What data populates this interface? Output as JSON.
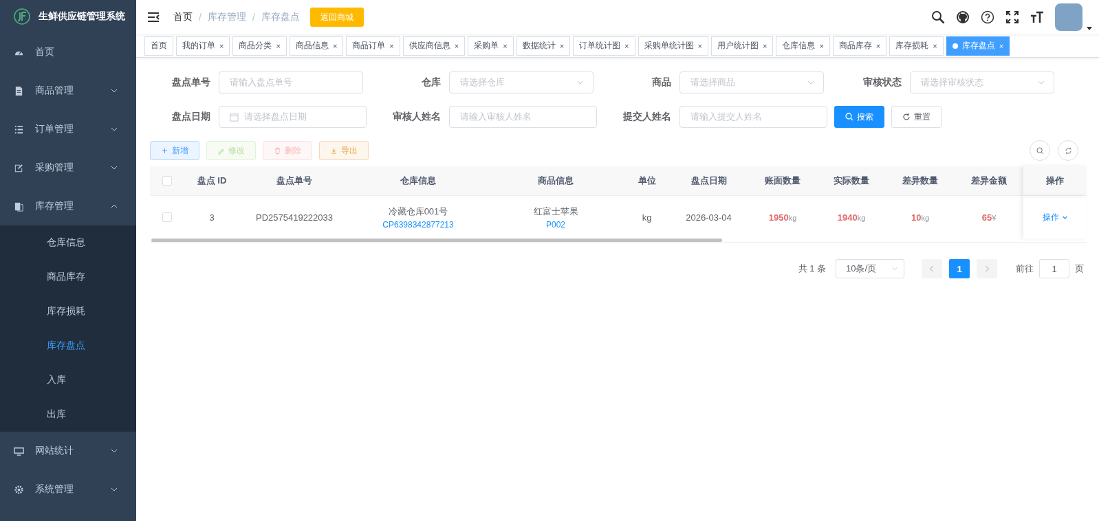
{
  "app": {
    "title": "生鲜供应链管理系统"
  },
  "sidebar": {
    "items": [
      {
        "label": "首页",
        "kind": "gauge",
        "selected": false
      },
      {
        "label": "商品管理",
        "kind": "doc",
        "selected": false,
        "expanded": false
      },
      {
        "label": "订单管理",
        "kind": "list",
        "selected": false,
        "expanded": false
      },
      {
        "label": "采购管理",
        "kind": "edit",
        "selected": false,
        "expanded": false
      },
      {
        "label": "库存管理",
        "kind": "copy",
        "selected": false,
        "expanded": true,
        "children": [
          {
            "label": "仓库信息",
            "selected": false
          },
          {
            "label": "商品库存",
            "selected": false
          },
          {
            "label": "库存损耗",
            "selected": false
          },
          {
            "label": "库存盘点",
            "selected": true
          },
          {
            "label": "入库",
            "selected": false
          },
          {
            "label": "出库",
            "selected": false
          }
        ]
      },
      {
        "label": "网站统计",
        "kind": "monitor",
        "selected": false,
        "expanded": false
      },
      {
        "label": "系统管理",
        "kind": "gear",
        "selected": false,
        "expanded": false
      }
    ]
  },
  "breadcrumb": [
    {
      "label": "首页",
      "link": true
    },
    {
      "label": "库存管理",
      "link": false
    },
    {
      "label": "库存盘点",
      "link": false
    }
  ],
  "breadcrumb_separator": "/",
  "return_button": "返回商城",
  "tags": [
    {
      "label": "首页",
      "selected": false
    },
    {
      "label": "我的订单",
      "selected": false,
      "close": "×"
    },
    {
      "label": "商品分类",
      "selected": false,
      "close": "×"
    },
    {
      "label": "商品信息",
      "selected": false,
      "close": "×"
    },
    {
      "label": "商品订单",
      "selected": false,
      "close": "×"
    },
    {
      "label": "供应商信息",
      "selected": false,
      "close": "×"
    },
    {
      "label": "采购单",
      "selected": false,
      "close": "×"
    },
    {
      "label": "数据统计",
      "selected": false,
      "close": "×"
    },
    {
      "label": "订单统计图",
      "selected": false,
      "close": "×"
    },
    {
      "label": "采购单统计图",
      "selected": false,
      "close": "×"
    },
    {
      "label": "用户统计图",
      "selected": false,
      "close": "×"
    },
    {
      "label": "仓库信息",
      "selected": false,
      "close": "×"
    },
    {
      "label": "商品库存",
      "selected": false,
      "close": "×"
    },
    {
      "label": "库存损耗",
      "selected": false,
      "close": "×"
    },
    {
      "label": "库存盘点",
      "selected": true,
      "close": "×"
    }
  ],
  "filters": [
    {
      "label": "盘点单号",
      "placeholder": "请输入盘点单号",
      "kind": "text"
    },
    {
      "label": "仓库",
      "placeholder": "请选择仓库",
      "kind": "select"
    },
    {
      "label": "商品",
      "placeholder": "请选择商品",
      "kind": "select"
    },
    {
      "label": "审核状态",
      "placeholder": "请选择审核状态",
      "kind": "select"
    },
    {
      "label": "盘点日期",
      "placeholder": "请选择盘点日期",
      "kind": "date"
    },
    {
      "label": "审核人姓名",
      "placeholder": "请输入审核人姓名",
      "kind": "text"
    },
    {
      "label": "提交人姓名",
      "placeholder": "请输入提交人姓名",
      "kind": "text"
    }
  ],
  "search_button": "搜索",
  "reset_button": "重置",
  "actions": [
    {
      "label": "新增",
      "kind": "add",
      "disabled": false
    },
    {
      "label": "修改",
      "kind": "edit",
      "disabled": true
    },
    {
      "label": "删除",
      "kind": "delete",
      "disabled": true
    },
    {
      "label": "导出",
      "kind": "export",
      "disabled": false
    }
  ],
  "table": {
    "select_all_checked": false,
    "columns": [
      "盘点 ID",
      "盘点单号",
      "仓库信息",
      "商品信息",
      "单位",
      "盘点日期",
      "账面数量",
      "实际数量",
      "差异数量",
      "差异金额",
      "操作"
    ],
    "rows": [
      {
        "checked": false,
        "id": "3",
        "number": "PD2575419222033",
        "warehouse": "冷藏仓库001号",
        "warehouse_code": "CP6398342877213",
        "product": "红富士苹果",
        "product_code": "P002",
        "unit": "kg",
        "date": "2026-03-04",
        "book_qty": {
          "value": "1950",
          "unit": "kg"
        },
        "actual_qty": {
          "value": "1940",
          "unit": "kg"
        },
        "diff_qty": {
          "value": "10",
          "unit": "kg"
        },
        "diff_amount": {
          "value": "65",
          "unit": "¥"
        },
        "operation": "操作"
      }
    ]
  },
  "pagination": {
    "total": "共 1 条",
    "page_size": "10条/页",
    "pages": [
      {
        "label": "1",
        "selected": true
      }
    ],
    "goto_label": "前往",
    "goto_value": "1",
    "goto_suffix": "页"
  }
}
